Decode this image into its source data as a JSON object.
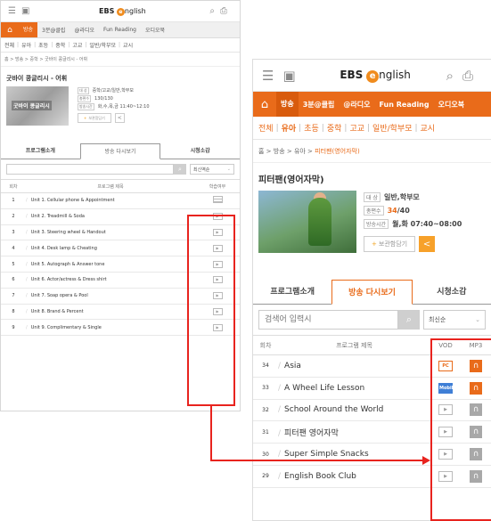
{
  "colors": {
    "accent": "#e96b1a",
    "highlight_frame": "#e8231e",
    "mobile_blue": "#3f7fd6"
  },
  "icons": {
    "menu": "hamburger-icon",
    "calendar": "calendar-icon",
    "search": "search-icon",
    "print": "print-icon",
    "home": "home-icon",
    "share": "share-icon",
    "play": "play-icon",
    "headphone": "headphones-icon"
  },
  "left": {
    "logo": {
      "ebs": "EBS",
      "e": "e",
      "rest": "nglish"
    },
    "nav": {
      "items": [
        "방송",
        "3분@클립",
        "@라디오",
        "Fun Reading",
        "오디오북"
      ]
    },
    "subnav": {
      "items": [
        "전체",
        "유아",
        "초등",
        "중학",
        "고교",
        "일반/학부모",
        "교시"
      ]
    },
    "breadcrumb": {
      "path": "홈 > 방송 > 중학 > 굿바이 콩글리시 - 어휘"
    },
    "program": {
      "title": "굿바이 콩글리시 - 어휘",
      "thumb_label": "굿바이 콩글리시",
      "meta": [
        {
          "key": "대  상",
          "value": "중학/고교/일반,학부모"
        },
        {
          "key": "총편수",
          "value": "130/130"
        },
        {
          "key": "방송시간",
          "value": "화,수,목,금 11:40~12:10"
        }
      ],
      "save_label": "보관함담기"
    },
    "tabs": [
      "프로그램소개",
      "방송 다시보기",
      "시청소감"
    ],
    "search": {
      "sort": "최신역순"
    },
    "table": {
      "headers": [
        "회차",
        "프로그램 제목",
        "학습여부"
      ],
      "rows": [
        {
          "num": "1",
          "title": "Unit 1. Cellular phone & Appointment",
          "icon": "doc"
        },
        {
          "num": "2",
          "title": "Unit 2. Treadmill & Soda",
          "icon": "play"
        },
        {
          "num": "3",
          "title": "Unit 3. Steering wheel & Handout",
          "icon": "play"
        },
        {
          "num": "4",
          "title": "Unit 4. Desk lamp & Cheating",
          "icon": "play"
        },
        {
          "num": "5",
          "title": "Unit 5. Autograph & Answer tone",
          "icon": "play"
        },
        {
          "num": "6",
          "title": "Unit 6. Actor/actress & Dress shirt",
          "icon": "play"
        },
        {
          "num": "7",
          "title": "Unit 7. Soap opera & Pool",
          "icon": "play"
        },
        {
          "num": "8",
          "title": "Unit 8. Brand & Percent",
          "icon": "play"
        },
        {
          "num": "9",
          "title": "Unit 9. Complimentary & Single",
          "icon": "play"
        }
      ]
    }
  },
  "right": {
    "logo": {
      "ebs": "EBS",
      "e": "e",
      "rest": "nglish"
    },
    "nav": {
      "items": [
        "방송",
        "3분@클립",
        "@라디오",
        "Fun Reading",
        "오디오북"
      ]
    },
    "subnav": {
      "items": [
        "전체",
        "유아",
        "초등",
        "중학",
        "고교",
        "일반/학부모",
        "교시"
      ]
    },
    "breadcrumb": {
      "prefix": "홈 > 방송 > 유아 > ",
      "current": "피터팬(영어자막)"
    },
    "program": {
      "title": "피터팬(영어자막)",
      "meta": [
        {
          "key": "대  상",
          "value": "일반,학부모"
        },
        {
          "key": "총편수",
          "value_hl": "34",
          "value_rest": "/40"
        },
        {
          "key": "방송시간",
          "value": "월,화 07:40~08:00"
        }
      ],
      "save_label": "보관함담기"
    },
    "tabs": [
      "프로그램소개",
      "방송 다시보기",
      "시청소감"
    ],
    "search": {
      "placeholder": "검색어 입력시",
      "sort": "최신순"
    },
    "table": {
      "headers": [
        "회차",
        "프로그램 제목",
        "VOD",
        "MP3"
      ],
      "rows": [
        {
          "num": "34",
          "title": "Asia",
          "vod": "PC",
          "vod_type": "pc",
          "mp3": "hot"
        },
        {
          "num": "33",
          "title": "A Wheel Life Lesson",
          "vod": "Mobile",
          "vod_type": "mobile",
          "mp3": "hot"
        },
        {
          "num": "32",
          "title": "School Around the World",
          "vod": "▶",
          "vod_type": "play",
          "mp3": "gray"
        },
        {
          "num": "31",
          "title": "피터팬 영어자막",
          "vod": "▶",
          "vod_type": "play",
          "mp3": "gray"
        },
        {
          "num": "30",
          "title": "Super Simple Snacks",
          "vod": "▶",
          "vod_type": "play",
          "mp3": "gray"
        },
        {
          "num": "29",
          "title": "English Book Club",
          "vod": "▶",
          "vod_type": "play",
          "mp3": "gray"
        }
      ]
    }
  }
}
